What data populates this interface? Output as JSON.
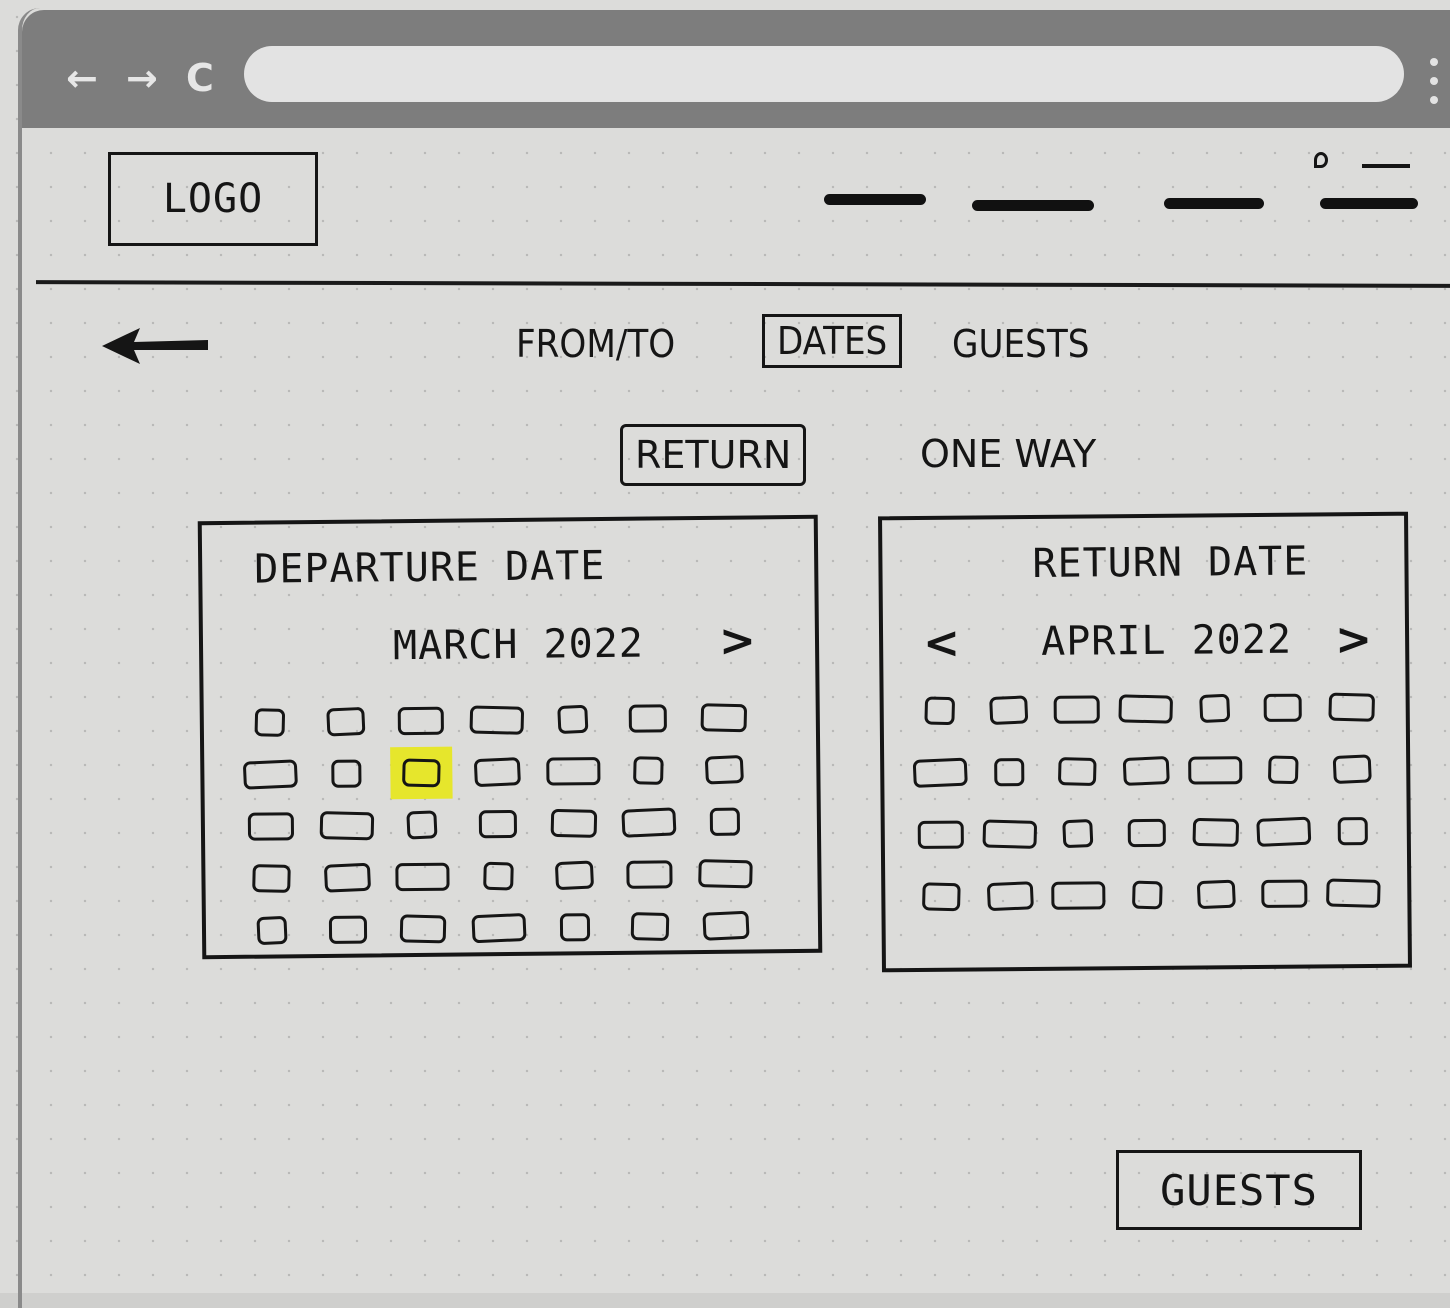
{
  "browser": {
    "back_icon": "←",
    "forward_icon": "→",
    "reload_icon": "C"
  },
  "header": {
    "logo_text": "LOGO"
  },
  "steps": [
    {
      "label": "FROM/TO",
      "active": false
    },
    {
      "label": "DATES",
      "active": true
    },
    {
      "label": "GUESTS",
      "active": false
    }
  ],
  "trip_type": {
    "return_label": "RETURN",
    "one_way_label": "ONE WAY",
    "selected": "RETURN"
  },
  "departure": {
    "title": "DEPARTURE DATE",
    "month": "MARCH 2022",
    "next_icon": ">",
    "rows": 5,
    "cols": 7,
    "highlighted": {
      "row": 2,
      "col": 3
    },
    "highlight_color": "#e6e62c"
  },
  "return_cal": {
    "title": "RETURN DATE",
    "month": "APRIL 2022",
    "prev_icon": "<",
    "next_icon": ">",
    "rows": 4,
    "cols": 7
  },
  "footer": {
    "guests_button": "GUESTS"
  }
}
